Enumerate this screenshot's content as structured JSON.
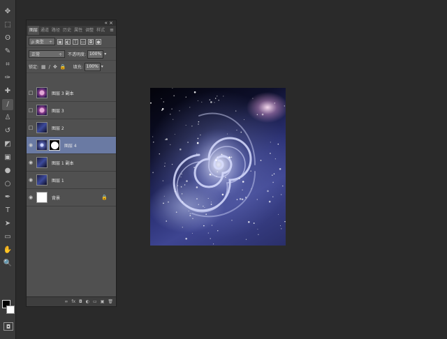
{
  "tools": {
    "icons": [
      "move-icon",
      "marquee-icon",
      "lasso-icon",
      "quick-select-icon",
      "crop-icon",
      "eyedropper-icon",
      "spot-heal-icon",
      "brush-icon",
      "clone-stamp-icon",
      "history-brush-icon",
      "eraser-icon",
      "gradient-icon",
      "blur-icon",
      "dodge-icon",
      "pen-icon",
      "type-icon",
      "path-select-icon",
      "shape-icon",
      "hand-icon",
      "zoom-icon"
    ],
    "glyphs": [
      "✥",
      "⬚",
      "ʘ",
      "✎",
      "⌗",
      "✑",
      "✚",
      "/",
      "♙",
      "↺",
      "◩",
      "▣",
      "●",
      "○",
      "✒",
      "T",
      "➤",
      "▭",
      "✋",
      "🔍"
    ]
  },
  "layers_panel": {
    "tabs": [
      "图层",
      "通道",
      "路径",
      "历史",
      "属性",
      "调整",
      "样式"
    ],
    "kind_filter": "ρ 类型",
    "blend_mode": "正常",
    "opacity_label": "不透明度:",
    "opacity_value": "100%",
    "lock_label": "锁定:",
    "fill_label": "填充:",
    "fill_value": "100%",
    "layers": [
      {
        "name": "图层 3 副本",
        "visible": false,
        "thumb": "t-purple",
        "selected": false,
        "mask": false,
        "locked": false
      },
      {
        "name": "图层 3",
        "visible": false,
        "thumb": "t-purple",
        "selected": false,
        "mask": false,
        "locked": false
      },
      {
        "name": "图层 2",
        "visible": false,
        "thumb": "t-blue",
        "selected": false,
        "mask": false,
        "locked": false
      },
      {
        "name": "图层 4",
        "visible": true,
        "thumb": "t-swirl",
        "selected": true,
        "mask": true,
        "locked": false
      },
      {
        "name": "图层 1 副本",
        "visible": true,
        "thumb": "t-blue",
        "selected": false,
        "mask": false,
        "locked": false
      },
      {
        "name": "图层 1",
        "visible": true,
        "thumb": "t-blue",
        "selected": false,
        "mask": false,
        "locked": false
      },
      {
        "name": "背景",
        "visible": true,
        "thumb": "t-white",
        "selected": false,
        "mask": false,
        "locked": true
      }
    ],
    "footer_icons": [
      "∞",
      "fx",
      "◘",
      "◐",
      "▭",
      "▣",
      "🗑"
    ]
  }
}
